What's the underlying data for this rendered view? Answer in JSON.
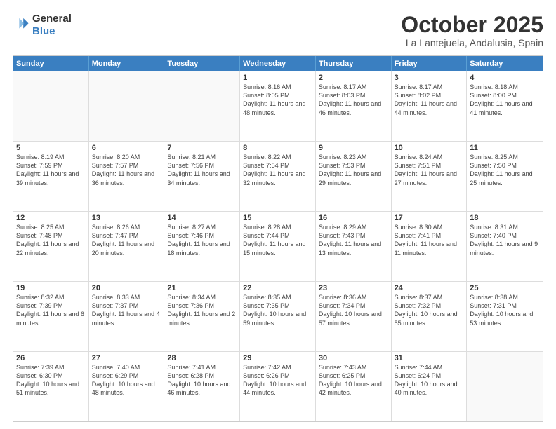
{
  "header": {
    "logo_line1": "General",
    "logo_line2": "Blue",
    "month": "October 2025",
    "location": "La Lantejuela, Andalusia, Spain"
  },
  "weekdays": [
    "Sunday",
    "Monday",
    "Tuesday",
    "Wednesday",
    "Thursday",
    "Friday",
    "Saturday"
  ],
  "rows": [
    [
      {
        "day": "",
        "empty": true
      },
      {
        "day": "",
        "empty": true
      },
      {
        "day": "",
        "empty": true
      },
      {
        "day": "1",
        "sunrise": "8:16 AM",
        "sunset": "8:05 PM",
        "daylight": "11 hours and 48 minutes."
      },
      {
        "day": "2",
        "sunrise": "8:17 AM",
        "sunset": "8:03 PM",
        "daylight": "11 hours and 46 minutes."
      },
      {
        "day": "3",
        "sunrise": "8:17 AM",
        "sunset": "8:02 PM",
        "daylight": "11 hours and 44 minutes."
      },
      {
        "day": "4",
        "sunrise": "8:18 AM",
        "sunset": "8:00 PM",
        "daylight": "11 hours and 41 minutes."
      }
    ],
    [
      {
        "day": "5",
        "sunrise": "8:19 AM",
        "sunset": "7:59 PM",
        "daylight": "11 hours and 39 minutes."
      },
      {
        "day": "6",
        "sunrise": "8:20 AM",
        "sunset": "7:57 PM",
        "daylight": "11 hours and 36 minutes."
      },
      {
        "day": "7",
        "sunrise": "8:21 AM",
        "sunset": "7:56 PM",
        "daylight": "11 hours and 34 minutes."
      },
      {
        "day": "8",
        "sunrise": "8:22 AM",
        "sunset": "7:54 PM",
        "daylight": "11 hours and 32 minutes."
      },
      {
        "day": "9",
        "sunrise": "8:23 AM",
        "sunset": "7:53 PM",
        "daylight": "11 hours and 29 minutes."
      },
      {
        "day": "10",
        "sunrise": "8:24 AM",
        "sunset": "7:51 PM",
        "daylight": "11 hours and 27 minutes."
      },
      {
        "day": "11",
        "sunrise": "8:25 AM",
        "sunset": "7:50 PM",
        "daylight": "11 hours and 25 minutes."
      }
    ],
    [
      {
        "day": "12",
        "sunrise": "8:25 AM",
        "sunset": "7:48 PM",
        "daylight": "11 hours and 22 minutes."
      },
      {
        "day": "13",
        "sunrise": "8:26 AM",
        "sunset": "7:47 PM",
        "daylight": "11 hours and 20 minutes."
      },
      {
        "day": "14",
        "sunrise": "8:27 AM",
        "sunset": "7:46 PM",
        "daylight": "11 hours and 18 minutes."
      },
      {
        "day": "15",
        "sunrise": "8:28 AM",
        "sunset": "7:44 PM",
        "daylight": "11 hours and 15 minutes."
      },
      {
        "day": "16",
        "sunrise": "8:29 AM",
        "sunset": "7:43 PM",
        "daylight": "11 hours and 13 minutes."
      },
      {
        "day": "17",
        "sunrise": "8:30 AM",
        "sunset": "7:41 PM",
        "daylight": "11 hours and 11 minutes."
      },
      {
        "day": "18",
        "sunrise": "8:31 AM",
        "sunset": "7:40 PM",
        "daylight": "11 hours and 9 minutes."
      }
    ],
    [
      {
        "day": "19",
        "sunrise": "8:32 AM",
        "sunset": "7:39 PM",
        "daylight": "11 hours and 6 minutes."
      },
      {
        "day": "20",
        "sunrise": "8:33 AM",
        "sunset": "7:37 PM",
        "daylight": "11 hours and 4 minutes."
      },
      {
        "day": "21",
        "sunrise": "8:34 AM",
        "sunset": "7:36 PM",
        "daylight": "11 hours and 2 minutes."
      },
      {
        "day": "22",
        "sunrise": "8:35 AM",
        "sunset": "7:35 PM",
        "daylight": "10 hours and 59 minutes."
      },
      {
        "day": "23",
        "sunrise": "8:36 AM",
        "sunset": "7:34 PM",
        "daylight": "10 hours and 57 minutes."
      },
      {
        "day": "24",
        "sunrise": "8:37 AM",
        "sunset": "7:32 PM",
        "daylight": "10 hours and 55 minutes."
      },
      {
        "day": "25",
        "sunrise": "8:38 AM",
        "sunset": "7:31 PM",
        "daylight": "10 hours and 53 minutes."
      }
    ],
    [
      {
        "day": "26",
        "sunrise": "7:39 AM",
        "sunset": "6:30 PM",
        "daylight": "10 hours and 51 minutes."
      },
      {
        "day": "27",
        "sunrise": "7:40 AM",
        "sunset": "6:29 PM",
        "daylight": "10 hours and 48 minutes."
      },
      {
        "day": "28",
        "sunrise": "7:41 AM",
        "sunset": "6:28 PM",
        "daylight": "10 hours and 46 minutes."
      },
      {
        "day": "29",
        "sunrise": "7:42 AM",
        "sunset": "6:26 PM",
        "daylight": "10 hours and 44 minutes."
      },
      {
        "day": "30",
        "sunrise": "7:43 AM",
        "sunset": "6:25 PM",
        "daylight": "10 hours and 42 minutes."
      },
      {
        "day": "31",
        "sunrise": "7:44 AM",
        "sunset": "6:24 PM",
        "daylight": "10 hours and 40 minutes."
      },
      {
        "day": "",
        "empty": true
      }
    ]
  ]
}
